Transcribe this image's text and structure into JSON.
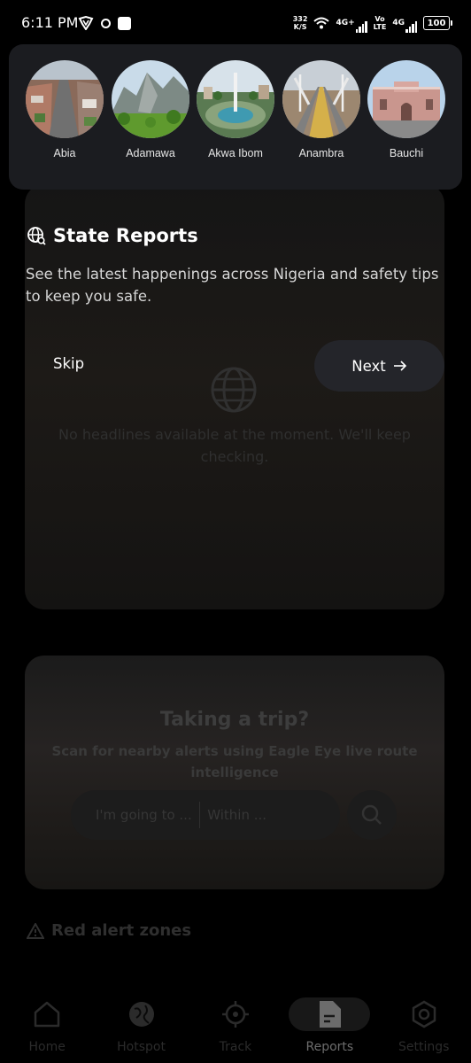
{
  "status_bar": {
    "time": "6:11 PM",
    "speed_value": "332",
    "speed_unit": "K/S",
    "network_1": "4G+",
    "volte_top": "Vo",
    "volte_bottom": "LTE",
    "network_2": "4G",
    "battery": "100"
  },
  "states": [
    {
      "name": "Abia"
    },
    {
      "name": "Adamawa"
    },
    {
      "name": "Akwa Ibom"
    },
    {
      "name": "Anambra"
    },
    {
      "name": "Bauchi"
    }
  ],
  "tour": {
    "title": "State Reports",
    "description": "See the latest happenings across Nigeria and safety tips to keep you safe.",
    "skip_label": "Skip",
    "next_label": "Next",
    "next_icon": "arrow-right-icon"
  },
  "background": {
    "empty_state": "No headlines available at the moment. We'll keep checking.",
    "trip": {
      "title": "Taking a trip?",
      "subtitle": "Scan for nearby alerts using Eagle Eye live route intelligence",
      "destination_placeholder": "I'm going to ...",
      "radius_placeholder": "Within ..."
    },
    "red_alert_title": "Red alert zones",
    "nav": [
      {
        "label": "Home",
        "icon": "home-icon",
        "active": false
      },
      {
        "label": "Hotspot",
        "icon": "globe-icon",
        "active": false
      },
      {
        "label": "Track",
        "icon": "crosshair-icon",
        "active": false
      },
      {
        "label": "Reports",
        "icon": "document-icon",
        "active": true
      },
      {
        "label": "Settings",
        "icon": "gear-icon",
        "active": false
      }
    ]
  },
  "colors": {
    "overlay_text": "#ffffff",
    "next_button_bg": "#24252a",
    "panel_bg": "#1b1c20"
  }
}
